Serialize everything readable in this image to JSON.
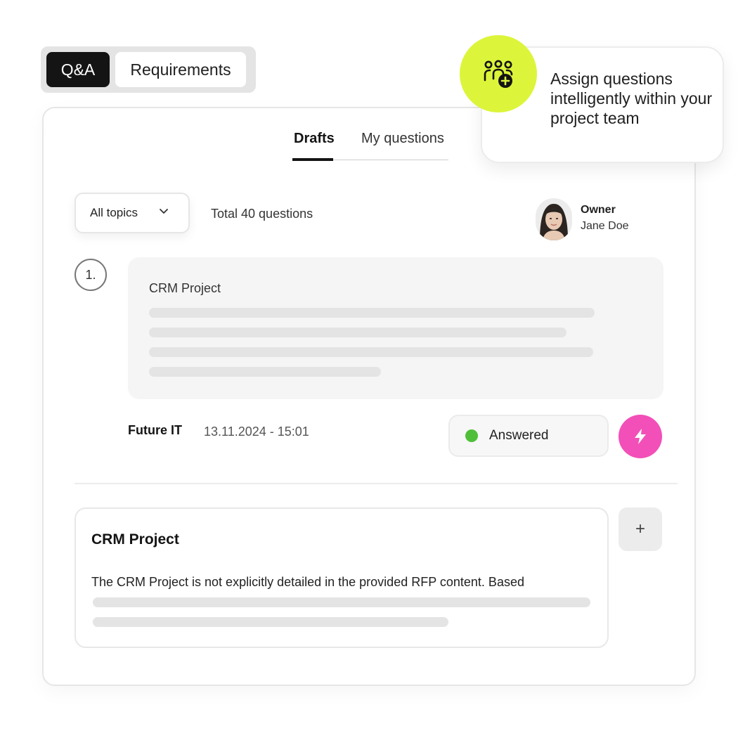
{
  "top_tabs": {
    "active": "Q&A",
    "inactive": "Requirements"
  },
  "sub_tabs": {
    "drafts": "Drafts",
    "my_questions": "My questions"
  },
  "filter": {
    "topics": "All topics",
    "total": "Total 40 questions"
  },
  "owner": {
    "role": "Owner",
    "name": "Jane Doe"
  },
  "question": {
    "number": "1.",
    "title": "CRM Project",
    "company": "Future IT",
    "datetime": "13.11.2024 - 15:01",
    "status": "Answered"
  },
  "answer": {
    "title": "CRM Project",
    "text": "The CRM Project is not explicitly detailed in the provided RFP content. Based",
    "add_label": "+"
  },
  "callout": {
    "text": "Assign questions intelligently within your project team",
    "icon": "team-add-icon"
  },
  "colors": {
    "accent_lime": "#dcf53a",
    "accent_pink": "#f24fb8",
    "status_green": "#4fbf3a",
    "dark": "#141414"
  }
}
